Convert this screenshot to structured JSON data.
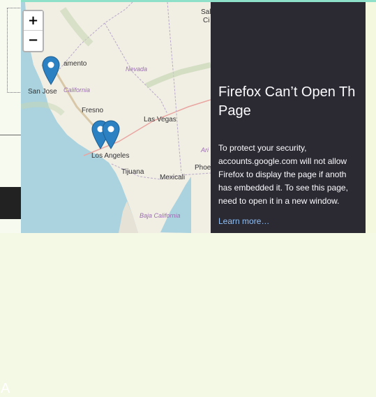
{
  "map": {
    "zoom_in_label": "+",
    "zoom_out_label": "−",
    "labels": {
      "salt_lake": "Salt L",
      "ci": "Ci",
      "sacramento": "amento",
      "nevada": "Nevada",
      "san_jose": "San Jose",
      "california": "California",
      "fresno": "Fresno",
      "las_vegas": "Las Vegas",
      "ari": "Ari",
      "phoe": "Phoe",
      "los_angeles": "Los Angeles",
      "tijuana": "Tijuana",
      "mexicali": "Mexicali",
      "baja_california": "Baja California"
    }
  },
  "error": {
    "title_line1": "Firefox Can’t Open Th",
    "title_line2": "Page",
    "body_lines": [
      "To protect your security,",
      "accounts.google.com will not allow",
      "Firefox to display the page if anoth",
      "has embedded it. To see this page,",
      "need to open it in a new window."
    ],
    "learn_more": "Learn more…"
  },
  "left_panel": {
    "letter": "A"
  },
  "colors": {
    "error_bg": "#2b2a33",
    "marker": "#2c81c3",
    "land": "#f1eee4",
    "water": "#aad3df",
    "top_border": "#8ee0c9"
  }
}
